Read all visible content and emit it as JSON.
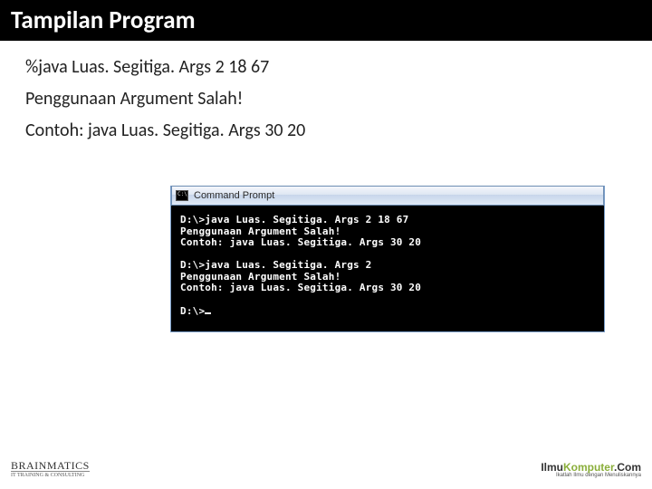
{
  "title": "Tampilan Program",
  "desc": {
    "line1": "%java Luas. Segitiga. Args 2 18 67",
    "line2": "Penggunaan Argument Salah!",
    "line3": "Contoh: java Luas. Segitiga. Args 30 20"
  },
  "cmd": {
    "window_title": "Command Prompt",
    "block1": "D:\\>java Luas. Segitiga. Args 2 18 67\nPenggunaan Argument Salah!\nContoh: java Luas. Segitiga. Args 30 20",
    "block2": "D:\\>java Luas. Segitiga. Args 2\nPenggunaan Argument Salah!\nContoh: java Luas. Segitiga. Args 30 20",
    "prompt": "D:\\>"
  },
  "footer": {
    "left_brand": "BRAINMATICS",
    "left_sub": "IT TRAINING & CONSULTING",
    "right_ilmu": "Ilmu",
    "right_komputer": "Komputer",
    "right_com": ".Com",
    "right_sub": "Ikatlah Ilmu dengan Menuliskannya"
  }
}
